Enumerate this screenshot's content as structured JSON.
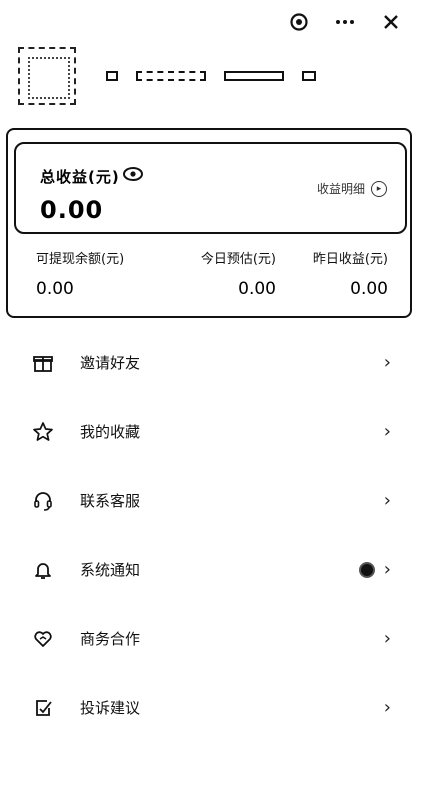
{
  "header": {
    "icons": [
      "settings-icon",
      "more-icon",
      "close-icon"
    ]
  },
  "card": {
    "total_label": "总收益(元)",
    "total_value": "0.00",
    "detail_label": "收益明细",
    "stats": [
      {
        "label": "可提现余额(元)",
        "value": "0.00"
      },
      {
        "label": "今日预估(元)",
        "value": "0.00"
      },
      {
        "label": "昨日收益(元)",
        "value": "0.00"
      }
    ]
  },
  "menu": [
    {
      "label": "邀请好友",
      "icon": "gift-icon"
    },
    {
      "label": "我的收藏",
      "icon": "star-icon"
    },
    {
      "label": "联系客服",
      "icon": "headset-icon"
    },
    {
      "label": "系统通知",
      "icon": "bell-icon"
    },
    {
      "label": "商务合作",
      "icon": "heart-icon"
    },
    {
      "label": "投诉建议",
      "icon": "edit-icon"
    }
  ],
  "chevron": "›"
}
